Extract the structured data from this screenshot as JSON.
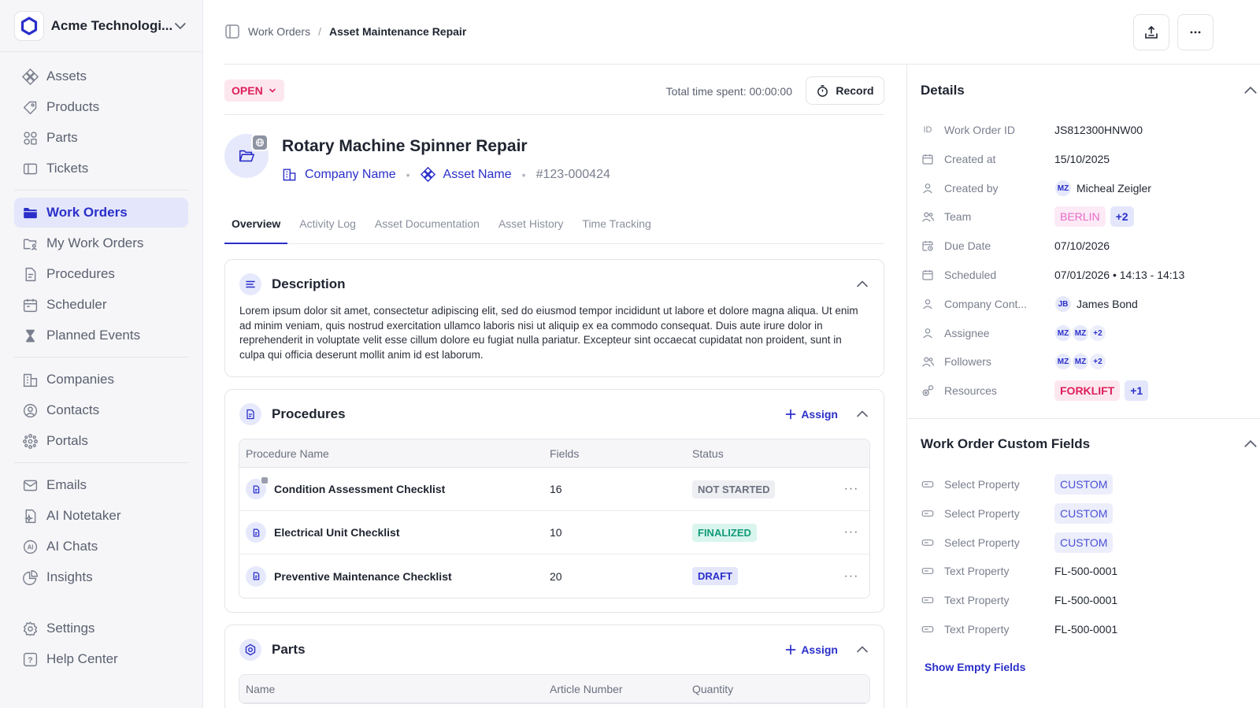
{
  "org": {
    "name": "Acme Technologi..."
  },
  "sidebar": {
    "groups": [
      [
        {
          "label": "Assets",
          "icon": "assets-icon"
        },
        {
          "label": "Products",
          "icon": "products-icon"
        },
        {
          "label": "Parts",
          "icon": "parts-icon"
        },
        {
          "label": "Tickets",
          "icon": "tickets-icon"
        }
      ],
      [
        {
          "label": "Work Orders",
          "icon": "folder-icon",
          "active": true
        },
        {
          "label": "My Work Orders",
          "icon": "my-folder-icon"
        },
        {
          "label": "Procedures",
          "icon": "document-icon"
        },
        {
          "label": "Scheduler",
          "icon": "calendar-icon"
        },
        {
          "label": "Planned Events",
          "icon": "hourglass-icon"
        }
      ],
      [
        {
          "label": "Companies",
          "icon": "building-icon"
        },
        {
          "label": "Contacts",
          "icon": "contact-icon"
        },
        {
          "label": "Portals",
          "icon": "portals-icon"
        }
      ],
      [
        {
          "label": "Emails",
          "icon": "mail-icon"
        },
        {
          "label": "AI Notetaker",
          "icon": "ai-notetaker-icon"
        },
        {
          "label": "AI Chats",
          "icon": "ai-chat-icon"
        },
        {
          "label": "Insights",
          "icon": "pie-chart-icon"
        }
      ],
      [
        {
          "label": "Settings",
          "icon": "gear-icon"
        },
        {
          "label": "Help Center",
          "icon": "help-icon"
        }
      ]
    ]
  },
  "breadcrumb": {
    "parent": "Work Orders",
    "separator": "/",
    "current": "Asset Maintenance Repair"
  },
  "status": {
    "label": "OPEN",
    "time_spent": "Total time spent: 00:00:00",
    "record_label": "Record"
  },
  "work_order": {
    "title": "Rotary Machine Spinner Repair",
    "company": "Company Name",
    "asset": "Asset Name",
    "number": "#123-000424"
  },
  "tabs": [
    "Overview",
    "Activity Log",
    "Asset Documentation",
    "Asset History",
    "Time Tracking"
  ],
  "description": {
    "title": "Description",
    "text": "Lorem ipsum dolor sit amet, consectetur adipiscing elit, sed do eiusmod tempor incididunt ut labore et dolore magna aliqua. Ut enim ad minim veniam, quis nostrud exercitation ullamco laboris nisi ut aliquip ex ea commodo consequat. Duis aute irure dolor in reprehenderit in voluptate velit esse cillum dolore eu fugiat nulla pariatur. Excepteur sint occaecat cupidatat non proident, sunt in culpa qui officia deserunt mollit anim id est laborum."
  },
  "procedures": {
    "title": "Procedures",
    "assign_label": "Assign",
    "columns": [
      "Procedure Name",
      "Fields",
      "Status"
    ],
    "rows": [
      {
        "name": "Condition Assessment Checklist",
        "fields": "16",
        "status": "NOT STARTED",
        "kind": "ns"
      },
      {
        "name": "Electrical Unit Checklist",
        "fields": "10",
        "status": "FINALIZED",
        "kind": "fin"
      },
      {
        "name": "Preventive Maintenance Checklist",
        "fields": "20",
        "status": "DRAFT",
        "kind": "dr"
      }
    ]
  },
  "parts": {
    "title": "Parts",
    "assign_label": "Assign",
    "columns": [
      "Name",
      "Article Number",
      "Quantity"
    ]
  },
  "details": {
    "title": "Details",
    "id_icon_text": "ID",
    "work_order_id": {
      "label": "Work Order ID",
      "value": "JS812300HNW00"
    },
    "created_at": {
      "label": "Created at",
      "value": "15/10/2025"
    },
    "created_by": {
      "label": "Created by",
      "initials": "MZ",
      "value": "Micheal Zeigler"
    },
    "team": {
      "label": "Team",
      "chip": "BERLIN",
      "more": "+2"
    },
    "due_date": {
      "label": "Due Date",
      "value": "07/10/2026"
    },
    "scheduled": {
      "label": "Scheduled",
      "value": "07/01/2026 • 14:13 - 14:13"
    },
    "company_contact": {
      "label": "Company Cont...",
      "initials": "JB",
      "value": "James Bond"
    },
    "assignee": {
      "label": "Assignee",
      "initials": [
        "MZ",
        "MZ"
      ],
      "more": "+2"
    },
    "followers": {
      "label": "Followers",
      "initials": [
        "MZ",
        "MZ"
      ],
      "more": "+2"
    },
    "resources": {
      "label": "Resources",
      "chip": "FORKLIFT",
      "more": "+1"
    }
  },
  "custom_fields": {
    "title": "Work Order Custom Fields",
    "rows": [
      {
        "label": "Select Property",
        "value": "CUSTOM",
        "chip": true
      },
      {
        "label": "Select Property",
        "value": "CUSTOM",
        "chip": true
      },
      {
        "label": "Select Property",
        "value": "CUSTOM",
        "chip": true
      },
      {
        "label": "Text Property",
        "value": "FL-500-0001",
        "chip": false
      },
      {
        "label": "Text Property",
        "value": "FL-500-0001",
        "chip": false
      },
      {
        "label": "Text Property",
        "value": "FL-500-0001",
        "chip": false
      }
    ],
    "show_empty": "Show Empty Fields"
  },
  "colors": {
    "accent": "#2a2fc9",
    "open": "#dc1f5c",
    "finalized": "#129b78"
  }
}
